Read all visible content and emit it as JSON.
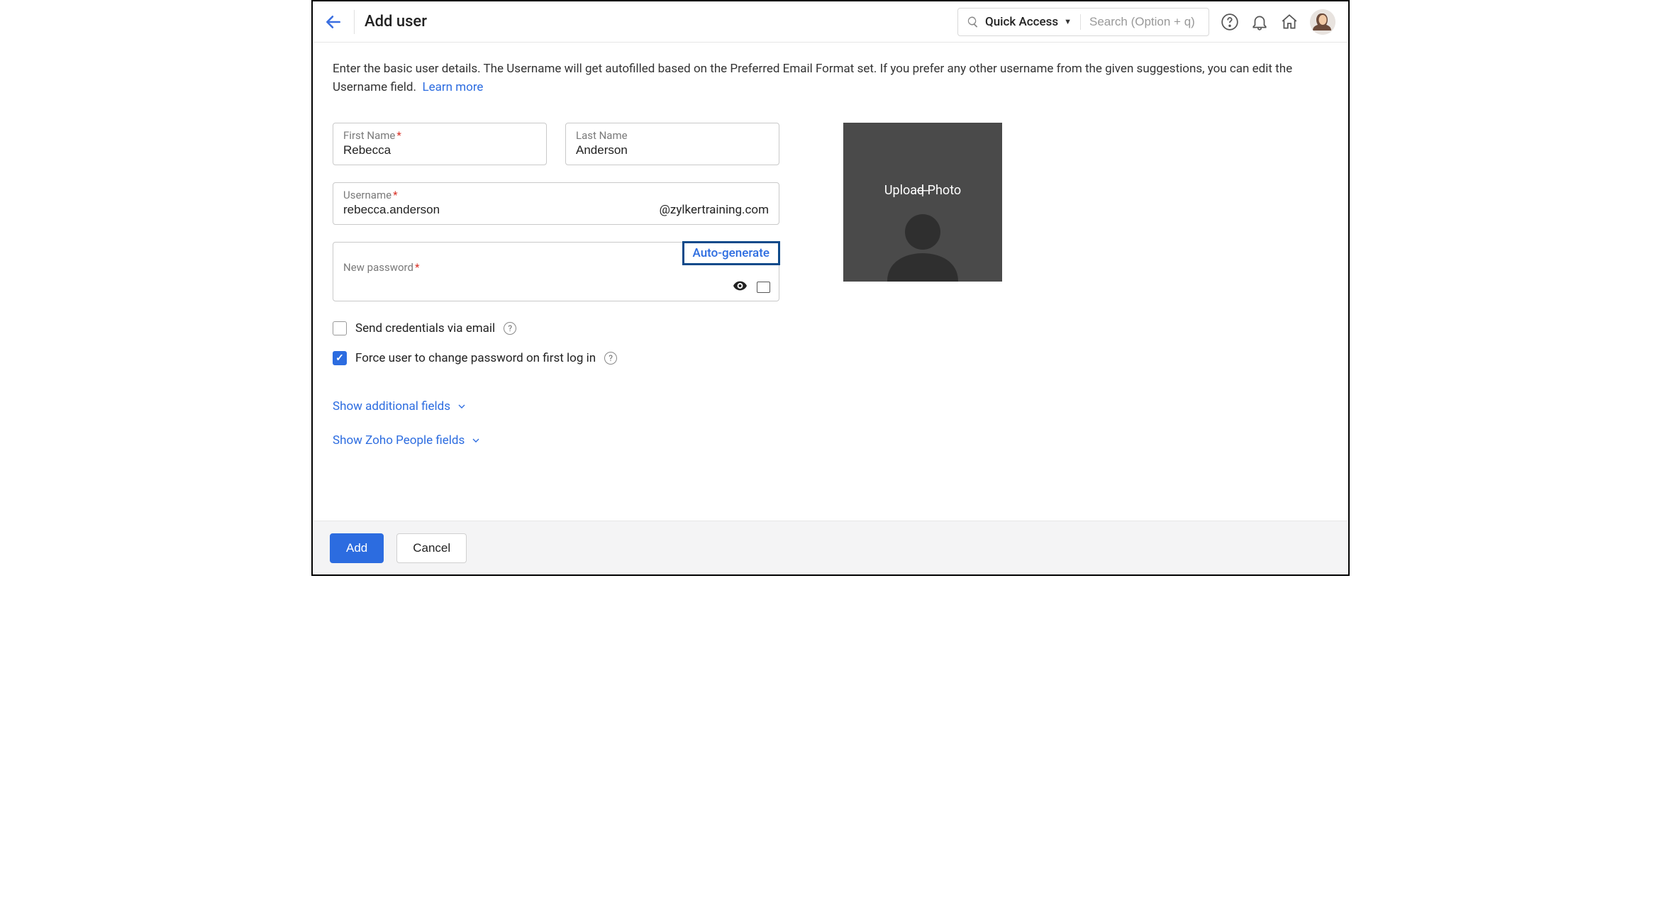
{
  "header": {
    "title": "Add user",
    "quick_access_label": "Quick Access",
    "search_placeholder": "Search (Option + q)"
  },
  "intro": {
    "text": "Enter the basic user details. The Username will get autofilled based on the Preferred Email Format set. If you prefer any other username from the given suggestions, you can edit the Username field.",
    "learn_more": "Learn more"
  },
  "fields": {
    "first_name_label": "First Name",
    "first_name_value": "Rebecca",
    "last_name_label": "Last Name",
    "last_name_value": "Anderson",
    "username_label": "Username",
    "username_value": "rebecca.anderson",
    "username_domain": "@zylkertraining.com",
    "password_label": "New password",
    "auto_generate": "Auto-generate"
  },
  "checkboxes": {
    "send_credentials": {
      "label": "Send credentials via email",
      "checked": false
    },
    "force_change": {
      "label": "Force user to change password on first log in",
      "checked": true
    }
  },
  "toggles": {
    "show_additional": "Show additional fields",
    "show_zoho": "Show Zoho People fields"
  },
  "photo": {
    "upload_label": "Upload Photo"
  },
  "footer": {
    "add": "Add",
    "cancel": "Cancel"
  }
}
